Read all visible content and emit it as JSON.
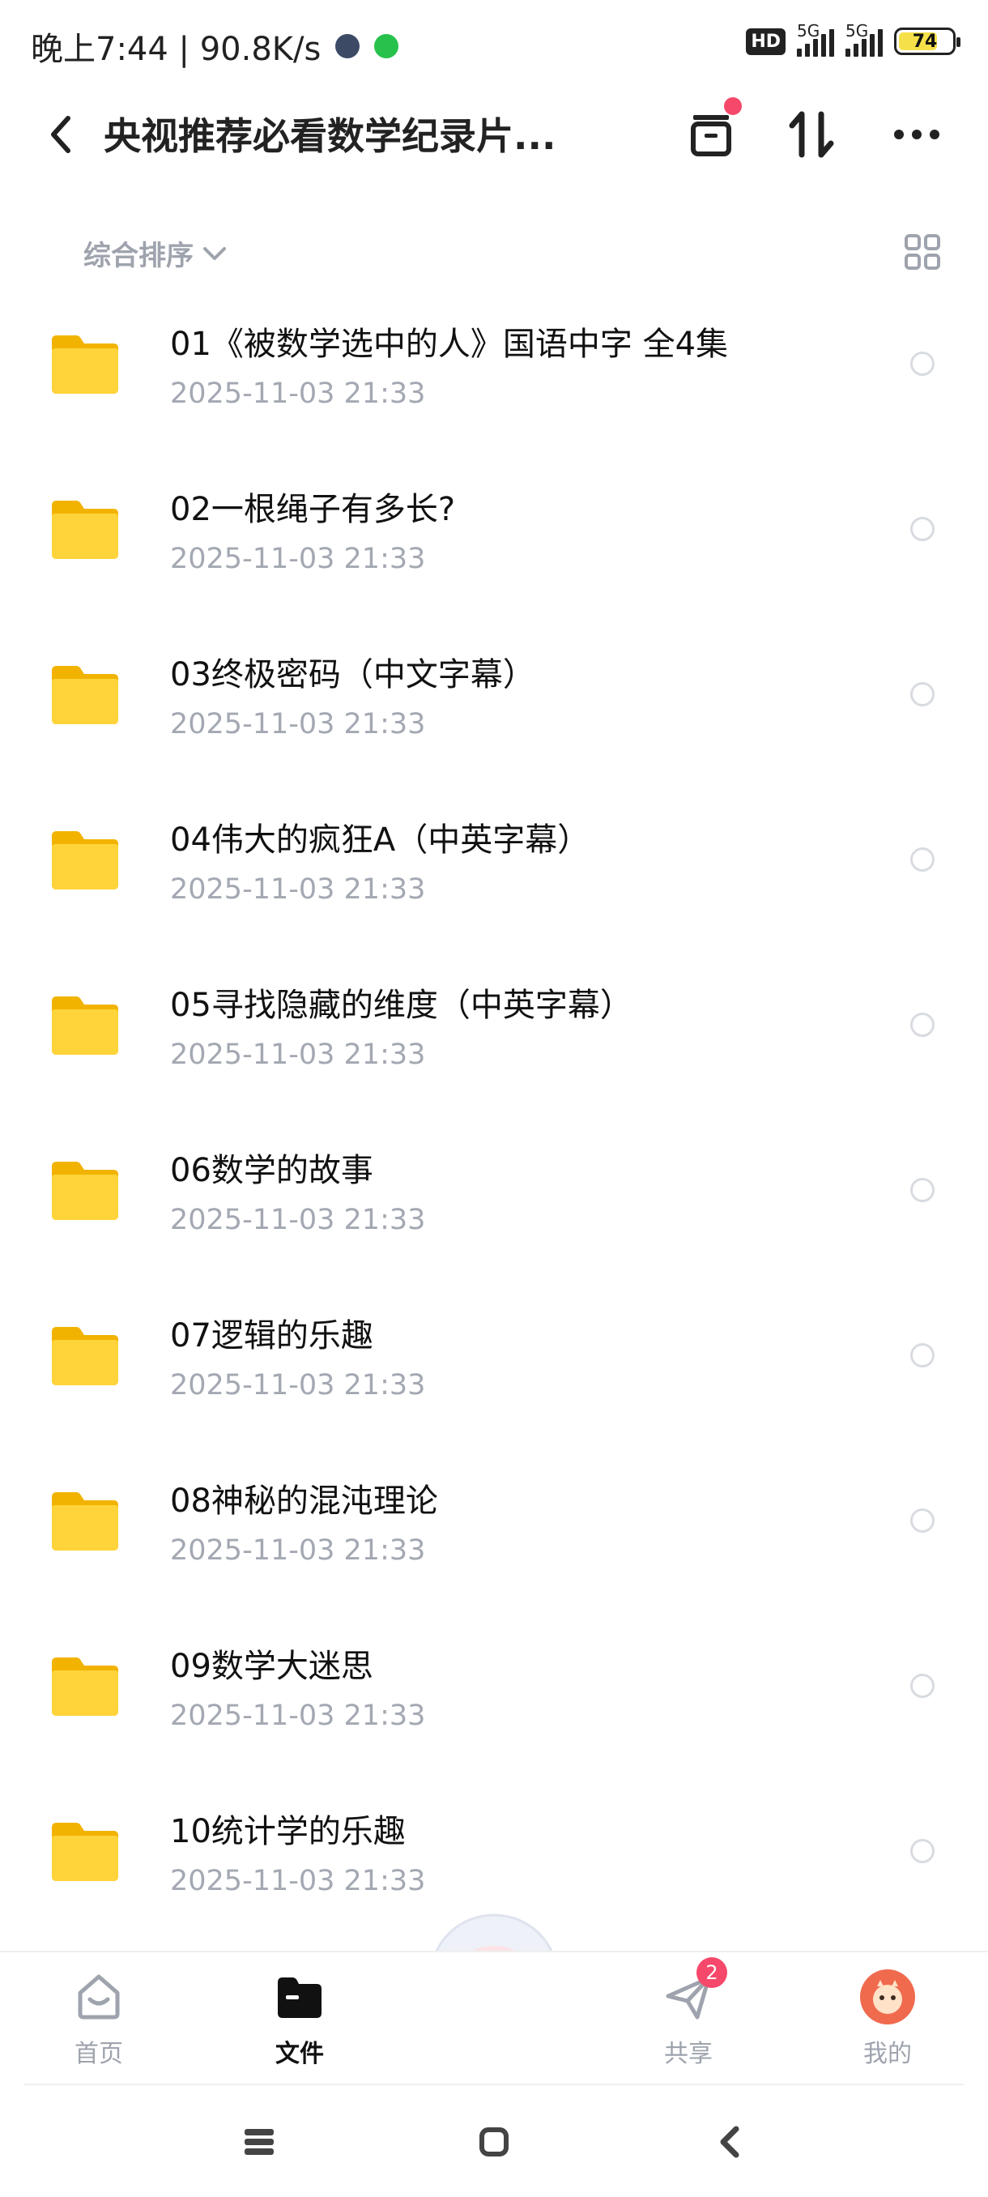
{
  "status_bar": {
    "time_speed": "晚上7:44 | 90.8K/s",
    "hd_label": "HD",
    "net_1": "5G",
    "net_2": "5G",
    "battery": "74",
    "battery_level": 0.74
  },
  "header": {
    "title": "央视推荐必看数学纪录片..."
  },
  "sort": {
    "label": "综合排序"
  },
  "files": [
    {
      "name": "01《被数学选中的人》国语中字 全4集",
      "date": "2025-11-03  21:33"
    },
    {
      "name": "02一根绳子有多长?",
      "date": "2025-11-03  21:33"
    },
    {
      "name": "03终极密码（中文字幕）",
      "date": "2025-11-03  21:33"
    },
    {
      "name": "04伟大的疯狂A（中英字幕）",
      "date": "2025-11-03  21:33"
    },
    {
      "name": "05寻找隐藏的维度（中英字幕）",
      "date": "2025-11-03  21:33"
    },
    {
      "name": "06数学的故事",
      "date": "2025-11-03  21:33"
    },
    {
      "name": "07逻辑的乐趣",
      "date": "2025-11-03  21:33"
    },
    {
      "name": "08神秘的混沌理论",
      "date": "2025-11-03  21:33"
    },
    {
      "name": "09数学大迷思",
      "date": "2025-11-03  21:33"
    },
    {
      "name": "10统计学的乐趣",
      "date": "2025-11-03  21:33"
    }
  ],
  "tabs": {
    "home": "首页",
    "files": "文件",
    "share": "共享",
    "share_badge": "2",
    "mine": "我的"
  },
  "colors": {
    "folder": "#ffd43a",
    "accent_red": "#f5486a",
    "muted_text": "#a3a8b2"
  }
}
